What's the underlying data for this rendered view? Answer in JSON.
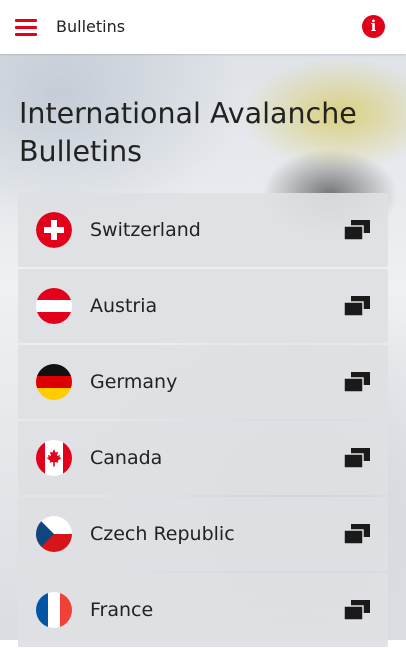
{
  "appbar": {
    "title": "Bulletins",
    "menu_icon": "hamburger-menu-icon",
    "info_icon": "info-icon",
    "accent_color": "#e3001b"
  },
  "main": {
    "heading": "International Avalanche Bulletins",
    "countries": [
      {
        "name": "Switzerland",
        "flag_icon": "switzerland-flag-icon"
      },
      {
        "name": "Austria",
        "flag_icon": "austria-flag-icon"
      },
      {
        "name": "Germany",
        "flag_icon": "germany-flag-icon"
      },
      {
        "name": "Canada",
        "flag_icon": "canada-flag-icon"
      },
      {
        "name": "Czech Republic",
        "flag_icon": "czech-flag-icon"
      },
      {
        "name": "France",
        "flag_icon": "france-flag-icon"
      }
    ],
    "row_action_icon": "open-in-new-window-icon"
  }
}
